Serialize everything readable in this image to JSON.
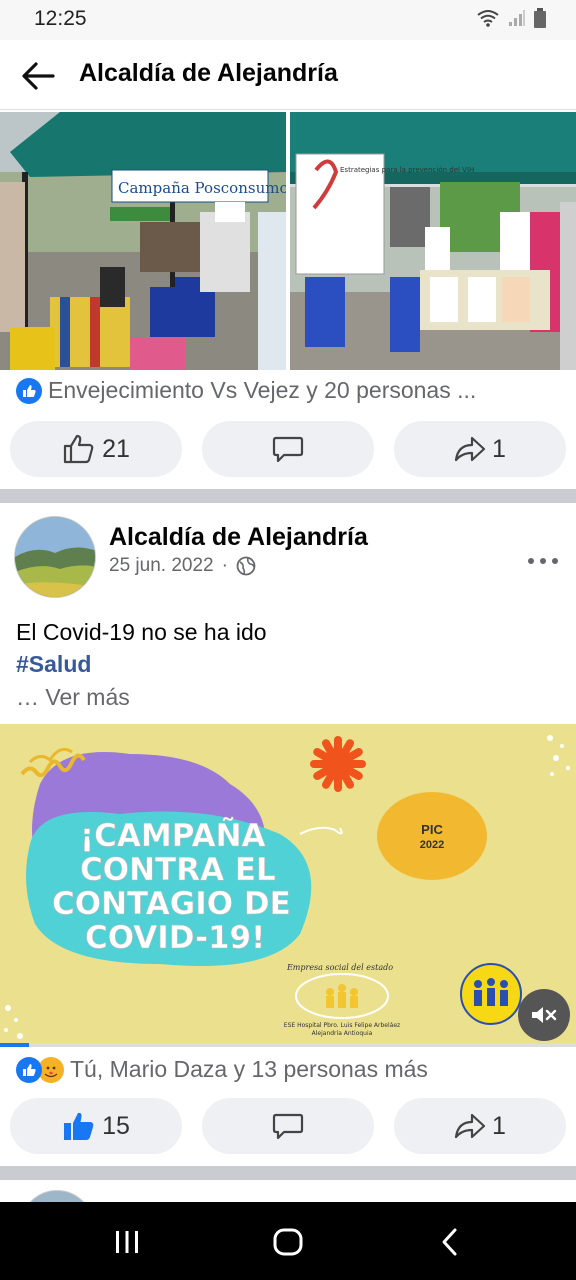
{
  "status_bar": {
    "time": "12:25"
  },
  "header": {
    "title": "Alcaldía de Alejandría"
  },
  "post1": {
    "photo_sign_left": "Campaña Posconsumo",
    "photo_sign_right": "Estrategias para la prevención del VIH",
    "reactions_text": "Envejecimiento Vs Vejez y 20 personas ...",
    "like_count": "21",
    "share_count": "1"
  },
  "post2": {
    "author": "Alcaldía de Alejandría",
    "date": "25 jun. 2022",
    "separator": "·",
    "text": "El Covid-19 no se ha ido",
    "hashtag": "#Salud",
    "see_more": "… Ver más",
    "campaign": {
      "line1": "¡CAMPAÑA",
      "line2": "CONTRA EL",
      "line3": "CONTAGIO DE",
      "line4": "COVID-19!",
      "badge_title": "PIC",
      "badge_year": "2022",
      "logo_top": "Empresa social del estado",
      "logo_bottom": "ESE Hospital Pbro. Luis Felipe Arbeláez",
      "logo_place": "Alejandría Antioquia"
    },
    "reactions_text": "Tú, Mario Daza y 13 personas más",
    "like_count": "15",
    "share_count": "1",
    "video_progress": 0.05
  },
  "colors": {
    "facebook_blue": "#1877f2",
    "campaign_bg": "#ebe08e"
  }
}
